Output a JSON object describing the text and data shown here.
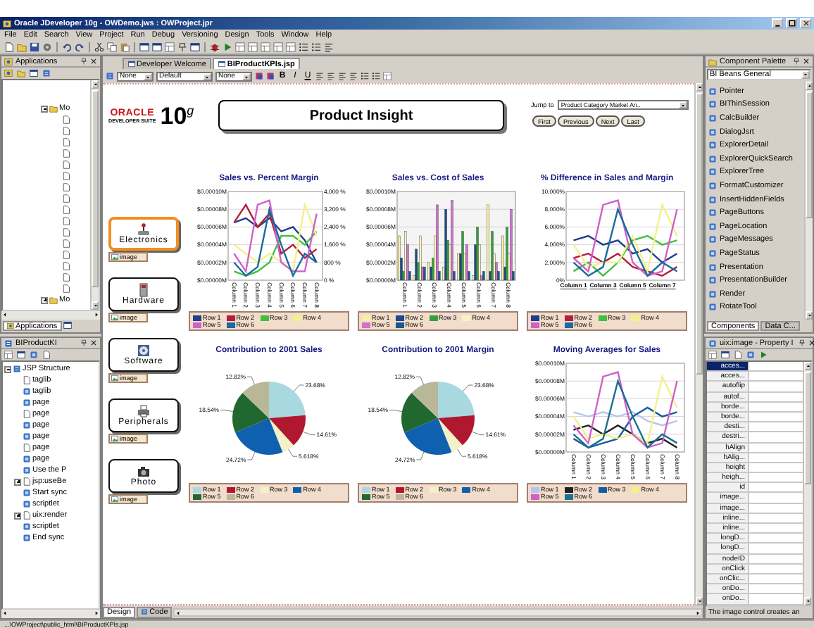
{
  "window": {
    "title": "Oracle JDeveloper 10g - OWDemo.jws : OWProject.jpr"
  },
  "menu": [
    "File",
    "Edit",
    "Search",
    "View",
    "Project",
    "Run",
    "Debug",
    "Versioning",
    "Design",
    "Tools",
    "Window",
    "Help"
  ],
  "applications_panel": {
    "title": "Applications",
    "tree": [
      {
        "label": "Mo",
        "expanded": true
      },
      {
        "label": "Mo",
        "expanded": false
      }
    ],
    "tabs": [
      {
        "label": "Applications",
        "selected": true
      }
    ]
  },
  "structure_panel": {
    "title": "BIProductKI",
    "tree": [
      {
        "label": "JSP Structure",
        "expanded": true,
        "children": [
          {
            "label": "taglib"
          },
          {
            "label": "taglib"
          },
          {
            "label": "page"
          },
          {
            "label": "page"
          },
          {
            "label": "page"
          },
          {
            "label": "page"
          },
          {
            "label": "page"
          },
          {
            "label": "page"
          },
          {
            "label": "Use the P"
          },
          {
            "label": "jsp:useBe",
            "expanded": false
          },
          {
            "label": "Start sync"
          },
          {
            "label": "scriptlet"
          },
          {
            "label": "uix:render",
            "expanded": false
          },
          {
            "label": "scriptlet"
          },
          {
            "label": "End sync"
          }
        ]
      }
    ]
  },
  "editor": {
    "tabs": [
      {
        "label": "Developer Welcome",
        "selected": false
      },
      {
        "label": "BIProductKPIs.jsp",
        "selected": true
      }
    ],
    "toolbar": {
      "selects": [
        "None",
        "Default",
        "None"
      ],
      "format_buttons": [
        "B",
        "I",
        "U"
      ]
    },
    "view_tabs": [
      {
        "label": "Design",
        "selected": true
      },
      {
        "label": "Code",
        "selected": false
      }
    ]
  },
  "page": {
    "logo": {
      "brand": "ORACLE",
      "product": "DEVELOPER SUITE",
      "version": "10$^{g}$"
    },
    "heading": "Product Insight",
    "jump": {
      "label": "Jump to",
      "value": "Product Category Market An.."
    },
    "nav_buttons": [
      "First",
      "Previous",
      "Next",
      "Last"
    ],
    "categories": [
      {
        "label": "Electronics",
        "tag": "image",
        "selected": true
      },
      {
        "label": "Hardware",
        "tag": "image",
        "selected": false
      },
      {
        "label": "Software",
        "tag": "image",
        "selected": false
      },
      {
        "label": "Peripherals",
        "tag": "image",
        "selected": false
      },
      {
        "label": "Photo",
        "tag": "image",
        "selected": false
      }
    ],
    "charts": [
      {
        "chart_data": {
          "type": "line",
          "grid": true,
          "legend": "bottom",
          "title": "Sales vs. Percent Margin",
          "categories": [
            "Column 1",
            "Column 2",
            "Column 3",
            "Column 4",
            "Column 5",
            "Column 6",
            "Column 7",
            "Column 8"
          ],
          "ylim": [
            0,
            0.0001
          ],
          "yticks": [
            {
              "value": 0,
              "label": "$0.00000M"
            },
            {
              "value": 2e-05,
              "label": "$0.00002M"
            },
            {
              "value": 4e-05,
              "label": "$0.00004M"
            },
            {
              "value": 6e-05,
              "label": "$0.00006M"
            },
            {
              "value": 8e-05,
              "label": "$0.00008M"
            },
            {
              "value": 0.0001,
              "label": "$0.00010M"
            }
          ],
          "y2lim": [
            0,
            4000
          ],
          "y2ticks": [
            {
              "value": 0,
              "label": "0 %"
            },
            {
              "value": 800,
              "label": "800 %"
            },
            {
              "value": 1600,
              "label": "1,600 %"
            },
            {
              "value": 2400,
              "label": "2,400 %"
            },
            {
              "value": 3200,
              "label": "3,200 %"
            },
            {
              "value": 4000,
              "label": "4,000 %"
            }
          ],
          "series": [
            {
              "name": "Row 1",
              "color": "#1f3d8a",
              "values": [
                6.5e-05,
                7e-05,
                6e-05,
                7e-05,
                5.5e-05,
                6e-05,
                4.5e-05,
                2e-05
              ]
            },
            {
              "name": "Row 2",
              "color": "#b0203a",
              "values": [
                6.5e-05,
                8.5e-05,
                6e-05,
                7.5e-05,
                3e-05,
                4e-05,
                2.5e-05,
                3.5e-05
              ]
            },
            {
              "name": "Row 3",
              "color": "#40c040",
              "values": [
                1e-05,
                5e-06,
                1e-05,
                2e-05,
                5e-05,
                5e-05,
                4e-05,
                5.5e-05
              ]
            },
            {
              "name": "Row 4",
              "color": "#f4f08a",
              "values": [
                4e-05,
                3e-05,
                2e-05,
                3e-05,
                2e-05,
                1e-05,
                8.5e-05,
                5e-05
              ]
            },
            {
              "name": "Row 5",
              "color": "#d060c8",
              "values": [
                3e-05,
                1e-05,
                8.5e-05,
                9e-05,
                2e-05,
                1e-05,
                1e-05,
                7.5e-05
              ]
            },
            {
              "name": "Row 6",
              "color": "#1a6aa0",
              "values": [
                2e-05,
                5e-06,
                1.5e-05,
                8e-05,
                4e-05,
                5e-06,
                3e-05,
                2e-05
              ]
            }
          ]
        }
      },
      {
        "chart_data": {
          "type": "bar",
          "grid": true,
          "legend": "bottom",
          "title": "Sales vs. Cost of Sales",
          "categories": [
            "Column 1",
            "Column 2",
            "Column 3",
            "Column 4",
            "Column 5",
            "Column 6",
            "Column 7",
            "Column 8"
          ],
          "ylim": [
            0,
            0.0001
          ],
          "yticks": [
            {
              "value": 0,
              "label": "$0.00000M"
            },
            {
              "value": 2e-05,
              "label": "$0.00002M"
            },
            {
              "value": 4e-05,
              "label": "$0.00004M"
            },
            {
              "value": 6e-05,
              "label": "$0.00006M"
            },
            {
              "value": 8e-05,
              "label": "$0.00008M"
            },
            {
              "value": 0.0001,
              "label": "$0.00010M"
            }
          ],
          "series": [
            {
              "name": "Row 1",
              "color": "#f6f0a0",
              "values": [
                5e-05,
                5e-06,
                2e-05,
                1.5e-05,
                3e-05,
                5e-06,
                8.5e-05,
                5e-05
              ]
            },
            {
              "name": "Row 2",
              "color": "#1a4a8a",
              "values": [
                2.5e-05,
                3.5e-05,
                1.5e-05,
                8e-05,
                3e-05,
                4e-05,
                1e-05,
                1.5e-05
              ]
            },
            {
              "name": "Row 3",
              "color": "#30a040",
              "values": [
                1e-05,
                2e-05,
                2.5e-05,
                4.5e-05,
                5.5e-05,
                6e-05,
                5.5e-05,
                6e-05
              ]
            },
            {
              "name": "Row 4",
              "color": "#f8f4c0",
              "values": [
                5.5e-05,
                5e-05,
                5e-05,
                4e-05,
                3e-05,
                4e-05,
                3e-05,
                3e-05
              ]
            },
            {
              "name": "Row 5",
              "color": "#d070d0",
              "values": [
                4e-05,
                1.5e-05,
                8.5e-05,
                9e-05,
                4e-05,
                5e-06,
                2e-05,
                8e-05
              ]
            },
            {
              "name": "Row 6",
              "color": "#1a5a8a",
              "values": [
                1e-05,
                1.5e-05,
                1e-05,
                1e-05,
                1e-05,
                1e-05,
                1e-05,
                1e-05
              ]
            }
          ]
        }
      },
      {
        "chart_data": {
          "type": "line",
          "grid": true,
          "legend": "bottom",
          "title": "% Difference in Sales and Margin",
          "categories": [
            "Column 1",
            null,
            "Column 3",
            null,
            "Column 5",
            null,
            "Column 7",
            null
          ],
          "ylim": [
            0,
            10000
          ],
          "yticks": [
            {
              "value": 0,
              "label": "0%"
            },
            {
              "value": 2000,
              "label": "2,000%"
            },
            {
              "value": 4000,
              "label": "4,000%"
            },
            {
              "value": 6000,
              "label": "6,000%"
            },
            {
              "value": 8000,
              "label": "8,000%"
            },
            {
              "value": 10000,
              "label": "10,000%"
            }
          ],
          "series": [
            {
              "name": "Row 1",
              "color": "#1f3d8a",
              "values": [
                4500,
                5000,
                4000,
                4500,
                3000,
                3500,
                2000,
                3000
              ]
            },
            {
              "name": "Row 2",
              "color": "#b0203a",
              "values": [
                2500,
                3000,
                2000,
                3000,
                1500,
                1000,
                500,
                1500
              ]
            },
            {
              "name": "Row 3",
              "color": "#40c040",
              "values": [
                1000,
                2000,
                500,
                2000,
                4500,
                5000,
                4000,
                4500
              ]
            },
            {
              "name": "Row 4",
              "color": "#f4f08a",
              "values": [
                4000,
                1500,
                2000,
                2000,
                5000,
                1000,
                8500,
                5000
              ]
            },
            {
              "name": "Row 5",
              "color": "#d060c8",
              "values": [
                2500,
                1000,
                8500,
                9000,
                2000,
                500,
                1000,
                8000
              ]
            },
            {
              "name": "Row 6",
              "color": "#1a6aa0",
              "values": [
                2000,
                500,
                1500,
                8000,
                4000,
                500,
                2000,
                1000
              ]
            }
          ]
        }
      },
      {
        "chart_data": {
          "type": "pie",
          "legend": "bottom",
          "title": "Contribution to 2001 Sales",
          "categories": [
            "Row 1",
            "Row 2",
            "Row 3",
            "Row 4",
            "Row 5",
            "Row 6"
          ],
          "values": [
            23.68,
            14.61,
            5.618,
            24.72,
            18.54,
            12.82
          ],
          "colors": [
            "#a8d8e0",
            "#b01830",
            "#f4f0c8",
            "#1060b0",
            "#206830",
            "#b8b898"
          ],
          "value_labels": [
            "23.68%",
            "14.61%",
            "5.618%",
            "24.72%",
            "18.54%",
            "12.82%"
          ]
        }
      },
      {
        "chart_data": {
          "type": "pie",
          "legend": "bottom",
          "title": "Contribution to 2001 Margin",
          "categories": [
            "Row 1",
            "Row 2",
            "Row 3",
            "Row 4",
            "Row 5",
            "Row 6"
          ],
          "values": [
            23.68,
            14.61,
            5.618,
            24.72,
            18.54,
            12.82
          ],
          "colors": [
            "#a8d8e0",
            "#b01830",
            "#f4f0c8",
            "#1060b0",
            "#206830",
            "#b8b898"
          ],
          "value_labels": [
            "23.68%",
            "14.61%",
            "5.618%",
            "24.72%",
            "18.54%",
            "12.82%"
          ]
        }
      },
      {
        "chart_data": {
          "type": "line",
          "grid": true,
          "legend": "bottom",
          "title": "Moving Averages for Sales",
          "categories": [
            "Column 1",
            "Column 2",
            "Column 3",
            "Column 4",
            "Column 5",
            "Column 6",
            "Column 7",
            "Column 8"
          ],
          "ylim": [
            0,
            0.0001
          ],
          "yticks": [
            {
              "value": 0,
              "label": "$0.00000M"
            },
            {
              "value": 2e-05,
              "label": "$0.00002M"
            },
            {
              "value": 4e-05,
              "label": "$0.00004M"
            },
            {
              "value": 6e-05,
              "label": "$0.00006M"
            },
            {
              "value": 8e-05,
              "label": "$0.00008M"
            },
            {
              "value": 0.0001,
              "label": "$0.00010M"
            }
          ],
          "series": [
            {
              "name": "Row 1",
              "color": "#b8c4f0",
              "values": [
                4.5e-05,
                4e-05,
                4.5e-05,
                4e-05,
                4.5e-05,
                3.5e-05,
                3e-05,
                3.5e-05
              ]
            },
            {
              "name": "Row 2",
              "color": "#202020",
              "values": [
                2.5e-05,
                3e-05,
                2e-05,
                3e-05,
                2e-05,
                1e-05,
                1.5e-05,
                5e-06
              ]
            },
            {
              "name": "Row 3",
              "color": "#1a5aa0",
              "values": [
                1.5e-05,
                5e-06,
                1e-05,
                1.5e-05,
                4e-05,
                5e-05,
                4e-05,
                4.5e-05
              ]
            },
            {
              "name": "Row 4",
              "color": "#f4f08a",
              "values": [
                4e-05,
                1.5e-05,
                2e-05,
                1.5e-05,
                2e-05,
                1e-05,
                8.5e-05,
                5e-05
              ]
            },
            {
              "name": "Row 5",
              "color": "#d060c8",
              "values": [
                3e-05,
                1e-05,
                8.5e-05,
                9e-05,
                2e-05,
                5e-06,
                1e-05,
                8e-05
              ]
            },
            {
              "name": "Row 6",
              "color": "#1a7090",
              "values": [
                2e-05,
                5e-06,
                1.5e-05,
                8e-05,
                4e-05,
                5e-06,
                2e-05,
                1e-05
              ]
            }
          ]
        }
      }
    ]
  },
  "palette": {
    "title": "Component Palette",
    "category": "BI Beans General",
    "items": [
      "Pointer",
      "BIThinSession",
      "CalcBuilder",
      "DialogJsrt",
      "ExplorerDetail",
      "ExplorerQuickSearch",
      "ExplorerTree",
      "FormatCustomizer",
      "InsertHiddenFields",
      "PageButtons",
      "PageLocation",
      "PageMessages",
      "PageStatus",
      "Presentation",
      "PresentationBuilder",
      "Render",
      "RotateTool"
    ],
    "tabs": [
      {
        "label": "Components",
        "selected": true
      },
      {
        "label": "Data C...",
        "selected": false
      }
    ]
  },
  "inspector": {
    "title": "uix:image - Property I",
    "properties": [
      {
        "name": "acces...",
        "selected": true
      },
      {
        "name": "acces...",
        "selected": false
      },
      {
        "name": "autoflip",
        "selected": false
      },
      {
        "name": "autof...",
        "selected": false
      },
      {
        "name": "borde...",
        "selected": false
      },
      {
        "name": "borde...",
        "selected": false
      },
      {
        "name": "desti...",
        "selected": false
      },
      {
        "name": "destri...",
        "selected": false
      },
      {
        "name": "hAlign",
        "selected": false
      },
      {
        "name": "hAlig...",
        "selected": false
      },
      {
        "name": "height",
        "selected": false
      },
      {
        "name": "heigh...",
        "selected": false
      },
      {
        "name": "id",
        "selected": false
      },
      {
        "name": "image...",
        "selected": false
      },
      {
        "name": "image...",
        "selected": false
      },
      {
        "name": "inline...",
        "selected": false
      },
      {
        "name": "inline...",
        "selected": false
      },
      {
        "name": "longD...",
        "selected": false
      },
      {
        "name": "longD...",
        "selected": false
      },
      {
        "name": "nodeID",
        "selected": false
      },
      {
        "name": "onClick",
        "selected": false
      },
      {
        "name": "onClic...",
        "selected": false
      },
      {
        "name": "onDo...",
        "selected": false
      },
      {
        "name": "onDo...",
        "selected": false
      }
    ],
    "description": "The image control creates an"
  },
  "status_bar": {
    "path": "...\\OWProject\\public_html\\BIProductKPIs.jsp"
  }
}
